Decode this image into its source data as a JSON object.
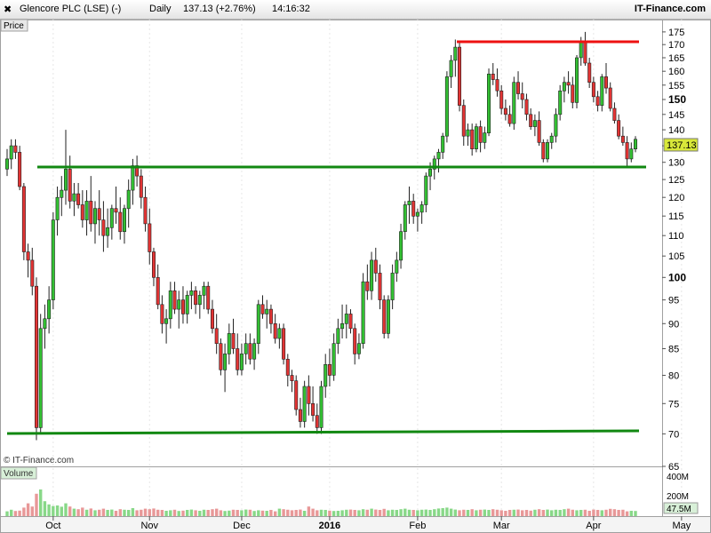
{
  "header": {
    "instrument": "Glencore PLC (LSE) (-)",
    "interval": "Daily",
    "last_quote": "137.13 (+2.76%)",
    "time": "14:16:32",
    "brand": "IT-Finance.com",
    "close_icon": "close-x-icon"
  },
  "panels": {
    "price_label": "Price",
    "volume_label": "Volume",
    "watermark": "© IT-Finance.com"
  },
  "colors": {
    "up": "#33c033",
    "down": "#e23434",
    "trendline_green": "#118811",
    "trendline_red": "#ee1111",
    "price_badge": "#d8e83a"
  },
  "chart_data": {
    "type": "candlestick",
    "scale": "log",
    "ylim": [
      65,
      180
    ],
    "yticks": [
      65,
      70,
      75,
      80,
      85,
      90,
      95,
      100,
      105,
      110,
      115,
      120,
      125,
      130,
      135,
      140,
      145,
      150,
      155,
      160,
      165,
      170,
      175
    ],
    "major_ticks": [
      100,
      150
    ],
    "last_price": "137.13",
    "x_months": [
      {
        "label": "Oct",
        "x_bar": 11
      },
      {
        "label": "Nov",
        "x_bar": 34
      },
      {
        "label": "Dec",
        "x_bar": 56
      },
      {
        "label": "2016",
        "x_bar": 77
      },
      {
        "label": "Feb",
        "x_bar": 98
      },
      {
        "label": "Mar",
        "x_bar": 118
      },
      {
        "label": "Apr",
        "x_bar": 140
      },
      {
        "label": "May",
        "x_bar": 161
      }
    ],
    "ohlc": [
      [
        128,
        134,
        126,
        131
      ],
      [
        131,
        137,
        128,
        135
      ],
      [
        135,
        137,
        131,
        133
      ],
      [
        133,
        135,
        122,
        123
      ],
      [
        123,
        124,
        104,
        106
      ],
      [
        106,
        108,
        100,
        104
      ],
      [
        104,
        107,
        96,
        98
      ],
      [
        98,
        100,
        69,
        71
      ],
      [
        71,
        92,
        70,
        89
      ],
      [
        89,
        94,
        85,
        91
      ],
      [
        91,
        98,
        88,
        95
      ],
      [
        95,
        116,
        93,
        114
      ],
      [
        114,
        123,
        110,
        120
      ],
      [
        120,
        126,
        115,
        122
      ],
      [
        122,
        140,
        118,
        128
      ],
      [
        128,
        132,
        117,
        119
      ],
      [
        119,
        124,
        115,
        121
      ],
      [
        121,
        124,
        117,
        118
      ],
      [
        118,
        122,
        112,
        114
      ],
      [
        114,
        122,
        110,
        119
      ],
      [
        119,
        126,
        111,
        113
      ],
      [
        113,
        119,
        108,
        117
      ],
      [
        117,
        122,
        110,
        114
      ],
      [
        114,
        119,
        106,
        110
      ],
      [
        110,
        117,
        107,
        112
      ],
      [
        112,
        118,
        109,
        117
      ],
      [
        117,
        123,
        113,
        116
      ],
      [
        116,
        120,
        109,
        111
      ],
      [
        111,
        118,
        108,
        117
      ],
      [
        117,
        125,
        112,
        122
      ],
      [
        122,
        131,
        118,
        129
      ],
      [
        129,
        132,
        123,
        126
      ],
      [
        126,
        128,
        117,
        120
      ],
      [
        120,
        123,
        111,
        113
      ],
      [
        113,
        117,
        103,
        106
      ],
      [
        106,
        107,
        98,
        100
      ],
      [
        100,
        103,
        93,
        94
      ],
      [
        94,
        96,
        88,
        90
      ],
      [
        90,
        93,
        86,
        91
      ],
      [
        91,
        99,
        89,
        97
      ],
      [
        97,
        99,
        92,
        93
      ],
      [
        93,
        97,
        89,
        95
      ],
      [
        95,
        98,
        90,
        92
      ],
      [
        92,
        97,
        90,
        96
      ],
      [
        96,
        99,
        93,
        97
      ],
      [
        97,
        98,
        92,
        94
      ],
      [
        94,
        97,
        91,
        96
      ],
      [
        96,
        99,
        93,
        98
      ],
      [
        98,
        99,
        92,
        93
      ],
      [
        93,
        95,
        88,
        89
      ],
      [
        89,
        92,
        84,
        86
      ],
      [
        86,
        87,
        80,
        81
      ],
      [
        81,
        86,
        77,
        84
      ],
      [
        84,
        90,
        82,
        88
      ],
      [
        88,
        91,
        84,
        85
      ],
      [
        85,
        88,
        80,
        81
      ],
      [
        81,
        86,
        80,
        84
      ],
      [
        84,
        88,
        82,
        86
      ],
      [
        86,
        88,
        82,
        83
      ],
      [
        83,
        87,
        81,
        86
      ],
      [
        86,
        95,
        84,
        94
      ],
      [
        94,
        96,
        91,
        92
      ],
      [
        92,
        95,
        89,
        93
      ],
      [
        93,
        94,
        88,
        90
      ],
      [
        90,
        92,
        86,
        87
      ],
      [
        87,
        90,
        85,
        89
      ],
      [
        89,
        90,
        82,
        83
      ],
      [
        83,
        84,
        78,
        80
      ],
      [
        80,
        81,
        77,
        79
      ],
      [
        79,
        80,
        73,
        74
      ],
      [
        74,
        76,
        71,
        72
      ],
      [
        72,
        79,
        71,
        78
      ],
      [
        78,
        80,
        73,
        75
      ],
      [
        75,
        78,
        72,
        73
      ],
      [
        73,
        75,
        70,
        71
      ],
      [
        71,
        79,
        70,
        78
      ],
      [
        78,
        84,
        76,
        82
      ],
      [
        82,
        85,
        78,
        80
      ],
      [
        80,
        88,
        79,
        86
      ],
      [
        86,
        91,
        84,
        89
      ],
      [
        89,
        94,
        87,
        90
      ],
      [
        90,
        94,
        87,
        92
      ],
      [
        92,
        93,
        88,
        89
      ],
      [
        89,
        90,
        82,
        84
      ],
      [
        84,
        88,
        83,
        86
      ],
      [
        86,
        101,
        85,
        99
      ],
      [
        99,
        103,
        95,
        97
      ],
      [
        97,
        106,
        95,
        104
      ],
      [
        104,
        107,
        99,
        101
      ],
      [
        101,
        103,
        93,
        95
      ],
      [
        95,
        96,
        87,
        88
      ],
      [
        88,
        96,
        87,
        95
      ],
      [
        95,
        103,
        93,
        101
      ],
      [
        101,
        106,
        99,
        104
      ],
      [
        104,
        113,
        102,
        111
      ],
      [
        111,
        119,
        109,
        118
      ],
      [
        118,
        123,
        113,
        119
      ],
      [
        119,
        121,
        113,
        115
      ],
      [
        115,
        117,
        111,
        116
      ],
      [
        116,
        119,
        113,
        118
      ],
      [
        118,
        127,
        116,
        126
      ],
      [
        126,
        130,
        122,
        128
      ],
      [
        128,
        132,
        125,
        131
      ],
      [
        131,
        134,
        127,
        133
      ],
      [
        133,
        139,
        131,
        138
      ],
      [
        138,
        160,
        136,
        158
      ],
      [
        158,
        166,
        154,
        164
      ],
      [
        164,
        172,
        158,
        169
      ],
      [
        169,
        171,
        146,
        148
      ],
      [
        148,
        150,
        135,
        138
      ],
      [
        138,
        142,
        135,
        140
      ],
      [
        140,
        142,
        132,
        134
      ],
      [
        134,
        142,
        133,
        141
      ],
      [
        141,
        143,
        133,
        136
      ],
      [
        136,
        141,
        134,
        139
      ],
      [
        139,
        161,
        138,
        159
      ],
      [
        159,
        163,
        155,
        157
      ],
      [
        157,
        161,
        151,
        153
      ],
      [
        153,
        155,
        145,
        147
      ],
      [
        147,
        150,
        143,
        145
      ],
      [
        145,
        148,
        141,
        142
      ],
      [
        142,
        158,
        140,
        156
      ],
      [
        156,
        160,
        150,
        152
      ],
      [
        152,
        156,
        147,
        150
      ],
      [
        150,
        152,
        143,
        145
      ],
      [
        145,
        147,
        140,
        141
      ],
      [
        141,
        145,
        138,
        143
      ],
      [
        143,
        146,
        135,
        136
      ],
      [
        136,
        137,
        130,
        131
      ],
      [
        131,
        137,
        130,
        136
      ],
      [
        136,
        139,
        134,
        138
      ],
      [
        138,
        147,
        136,
        145
      ],
      [
        145,
        155,
        143,
        153
      ],
      [
        153,
        158,
        149,
        156
      ],
      [
        156,
        160,
        152,
        155
      ],
      [
        155,
        158,
        147,
        149
      ],
      [
        149,
        166,
        147,
        165
      ],
      [
        165,
        173,
        162,
        171
      ],
      [
        171,
        175,
        162,
        163
      ],
      [
        163,
        165,
        154,
        156
      ],
      [
        156,
        158,
        149,
        151
      ],
      [
        151,
        153,
        146,
        148
      ],
      [
        148,
        159,
        146,
        158
      ],
      [
        158,
        163,
        152,
        154
      ],
      [
        154,
        156,
        146,
        147
      ],
      [
        147,
        149,
        142,
        143
      ],
      [
        143,
        145,
        137,
        138
      ],
      [
        138,
        141,
        135,
        136
      ],
      [
        136,
        138,
        129,
        131
      ],
      [
        131,
        136,
        130,
        134
      ],
      [
        134,
        138,
        133,
        137
      ]
    ],
    "volume_scale": {
      "max_m": 450,
      "ticks": [
        "400M",
        "200M"
      ],
      "last": "47.5M"
    },
    "volume_m": [
      45,
      60,
      48,
      52,
      80,
      120,
      90,
      210,
      250,
      140,
      110,
      95,
      100,
      88,
      120,
      90,
      70,
      65,
      80,
      60,
      72,
      55,
      60,
      70,
      58,
      62,
      50,
      65,
      60,
      58,
      75,
      55,
      60,
      70,
      65,
      72,
      60,
      58,
      50,
      55,
      60,
      48,
      52,
      58,
      62,
      55,
      50,
      60,
      58,
      65,
      70,
      55,
      48,
      52,
      60,
      58,
      55,
      62,
      60,
      48,
      55,
      52,
      50,
      58,
      45,
      70,
      65,
      60,
      55,
      58,
      62,
      50,
      90,
      70,
      55,
      60,
      58,
      52,
      48,
      50,
      55,
      60,
      62,
      58,
      55,
      65,
      60,
      70,
      62,
      58,
      68,
      55,
      60,
      58,
      65,
      70,
      60,
      58,
      55,
      60,
      62,
      58,
      65,
      72,
      75,
      80,
      70,
      62,
      55,
      60,
      58,
      65,
      55,
      60,
      62,
      58,
      65,
      60,
      55,
      50,
      58,
      60,
      62,
      55,
      58,
      52,
      60,
      65,
      58,
      62,
      55,
      60,
      58,
      65,
      70,
      60,
      55,
      58,
      60,
      50,
      62,
      58,
      55,
      60,
      68,
      65,
      58,
      60,
      45,
      50,
      48,
      40,
      35,
      45,
      60,
      40,
      48,
      60,
      40,
      48
    ]
  }
}
